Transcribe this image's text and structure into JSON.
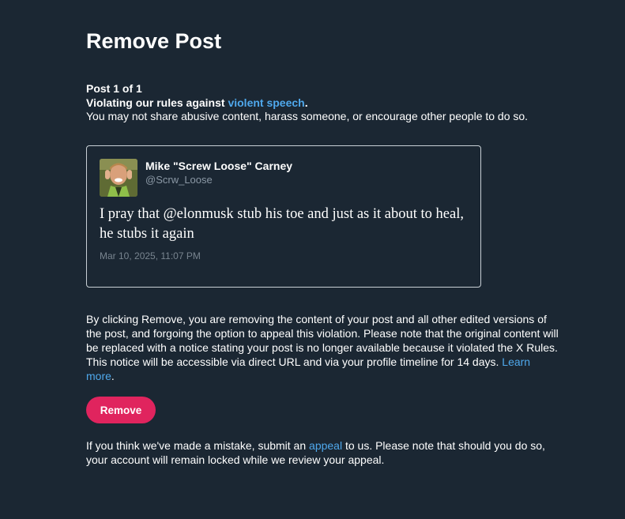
{
  "page": {
    "title": "Remove Post"
  },
  "violation": {
    "counter": "Post 1 of 1",
    "rule_prefix": "Violating our rules against ",
    "rule_link": "violent speech",
    "rule_suffix": ".",
    "rule_description": "You may not share abusive content, harass someone, or encourage other people to do so."
  },
  "post": {
    "author_name": "Mike \"Screw Loose\" Carney",
    "author_handle": "@Scrw_Loose",
    "text": "I pray that @elonmusk stub his toe and just as it about to heal, he stubs it again",
    "timestamp": "Mar 10, 2025, 11:07 PM"
  },
  "notice": {
    "body": "By clicking Remove, you are removing the content of your post and all other edited versions of the post, and forgoing the option to appeal this violation. Please note that the original content will be replaced with a notice stating your post is no longer available because it violated the X Rules. This notice will be accessible via direct URL and via your profile timeline for 14 days. ",
    "learn_more": "Learn more",
    "learn_more_suffix": "."
  },
  "actions": {
    "remove_label": "Remove"
  },
  "appeal": {
    "prefix": "If you think we've made a mistake, submit an ",
    "link": "appeal",
    "suffix": " to us. Please note that should you do so, your account will remain locked while we review your appeal."
  },
  "colors": {
    "background": "#1b2733",
    "link": "#4fa8ec",
    "remove_button": "#e0245e",
    "card_border": "#c9d0d6"
  }
}
